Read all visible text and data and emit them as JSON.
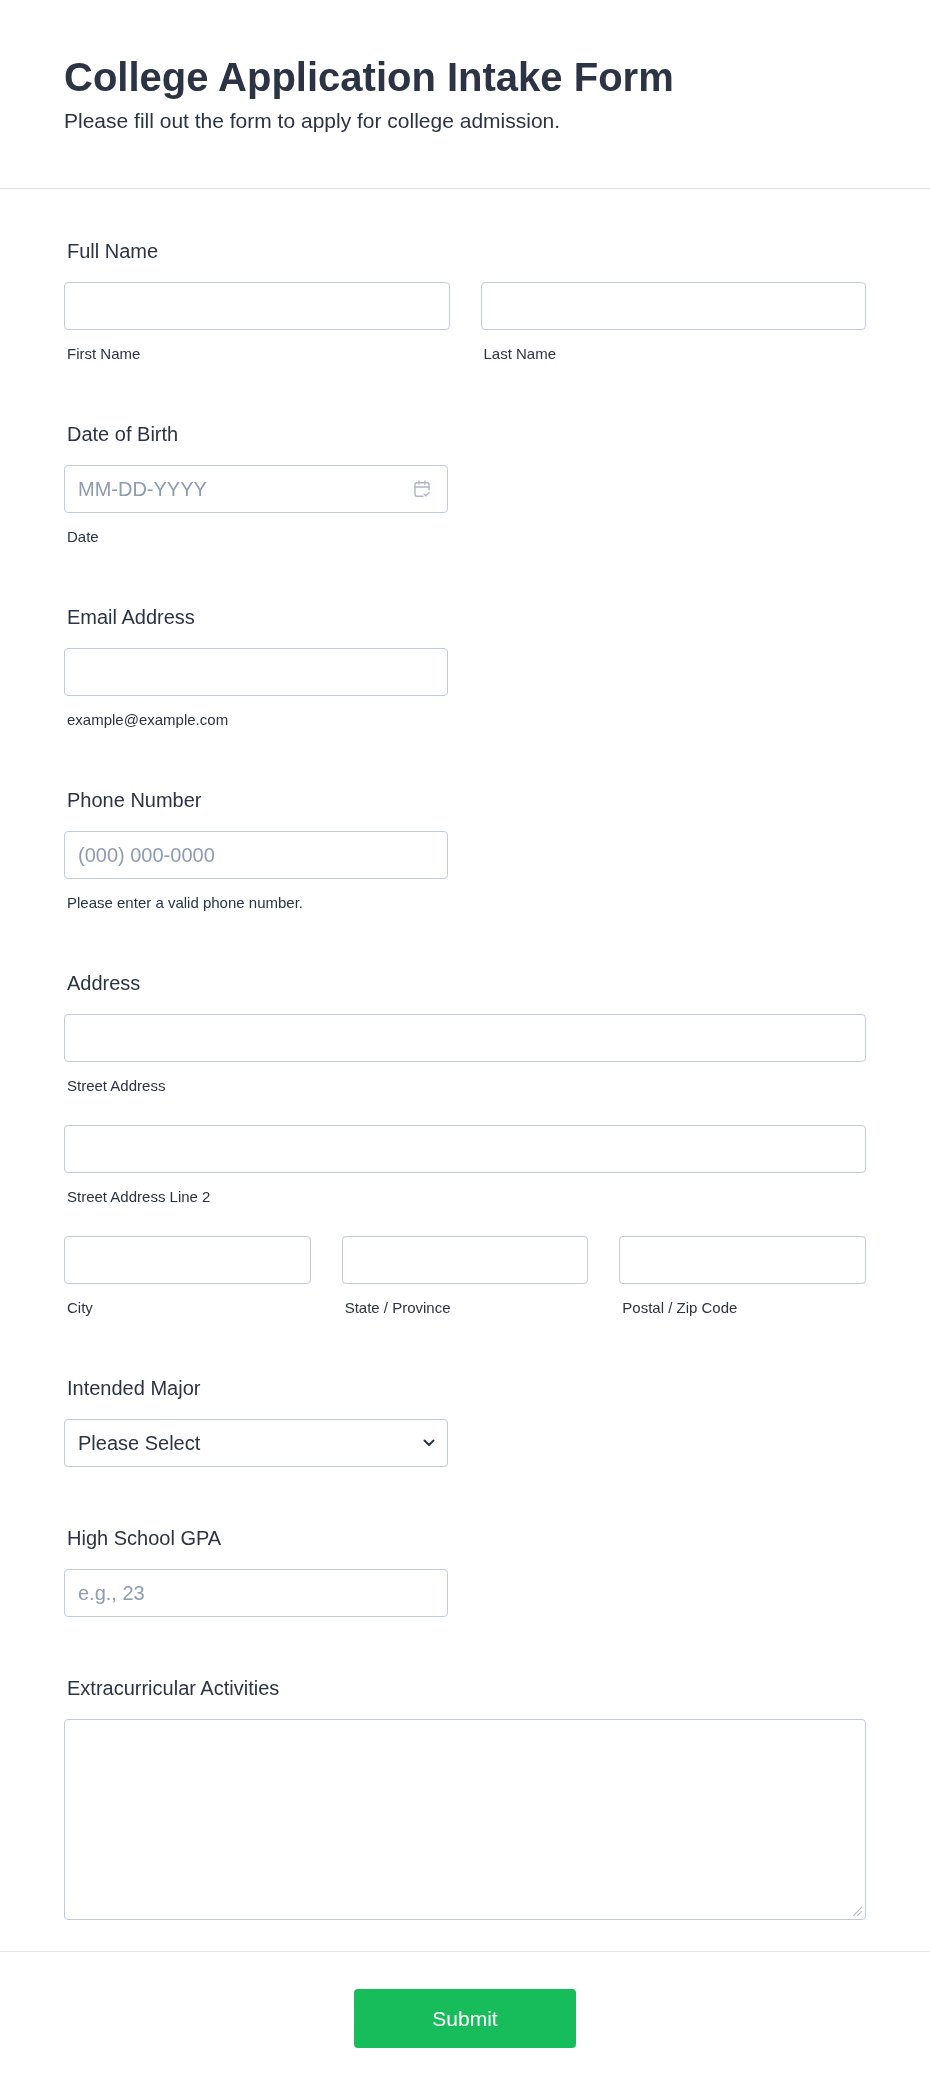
{
  "header": {
    "title": "College Application Intake Form",
    "subtitle": "Please fill out the form to apply for college admission."
  },
  "fields": [
    {
      "kind": "pair",
      "label": "Full Name",
      "inputs": [
        {
          "sublabel": "First Name"
        },
        {
          "sublabel": "Last Name"
        }
      ]
    },
    {
      "kind": "date",
      "label": "Date of Birth",
      "placeholder": "MM-DD-YYYY",
      "sublabel": "Date"
    },
    {
      "kind": "short",
      "label": "Email Address",
      "sublabel": "example@example.com"
    },
    {
      "kind": "short",
      "label": "Phone Number",
      "placeholder": "(000) 000-0000",
      "sublabel": "Please enter a valid phone number."
    },
    {
      "kind": "address",
      "label": "Address",
      "lines": [
        {
          "sublabel": "Street Address"
        },
        {
          "sublabel": "Street Address Line 2"
        }
      ],
      "parts": [
        {
          "sublabel": "City"
        },
        {
          "sublabel": "State / Province"
        },
        {
          "sublabel": "Postal / Zip Code"
        }
      ]
    },
    {
      "kind": "select",
      "label": "Intended Major",
      "value": "Please Select"
    },
    {
      "kind": "short",
      "label": "High School GPA",
      "placeholder": "e.g., 23"
    },
    {
      "kind": "textarea",
      "label": "Extracurricular Activities"
    }
  ],
  "submit": {
    "label": "Submit"
  }
}
